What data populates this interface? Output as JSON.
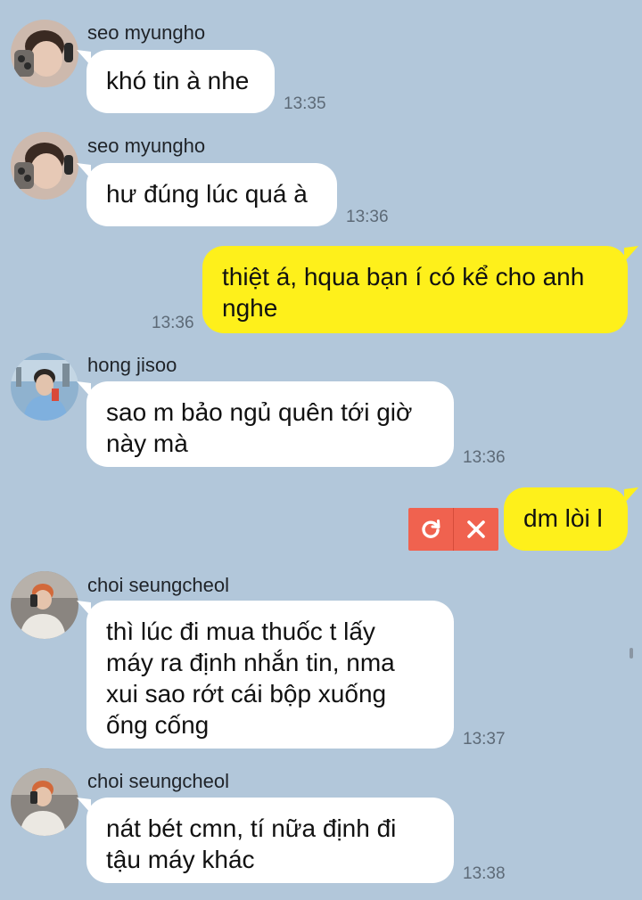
{
  "messages": [
    {
      "sender": "seo myungho",
      "text": "khó tin à nhe",
      "time": "13:35"
    },
    {
      "sender": "seo myungho",
      "text": "hư đúng lúc quá à",
      "time": "13:36"
    },
    {
      "text": "thiệt á, hqua bạn í có kể cho anh\nnghe",
      "time": "13:36"
    },
    {
      "sender": "hong jisoo",
      "text": "sao m bảo ngủ quên tới giờ\nnày mà",
      "time": "13:36"
    },
    {
      "text": "dm lòi l",
      "status": "failed",
      "actions": [
        "retry-icon",
        "close-icon"
      ]
    },
    {
      "sender": "choi seungcheol",
      "text": "thì lúc đi mua thuốc t lấy\nmáy ra định nhắn tin, nma\nxui sao rớt cái bộp xuống\nống cống",
      "time": "13:37"
    },
    {
      "sender": "choi seungcheol",
      "text": "nát bét cmn, tí nữa định đi\ntậu máy khác",
      "time": "13:38"
    }
  ],
  "colors": {
    "background": "#b2c7da",
    "incoming_bubble": "#ffffff",
    "outgoing_bubble": "#fef01b",
    "failed_action": "#f0624f"
  }
}
